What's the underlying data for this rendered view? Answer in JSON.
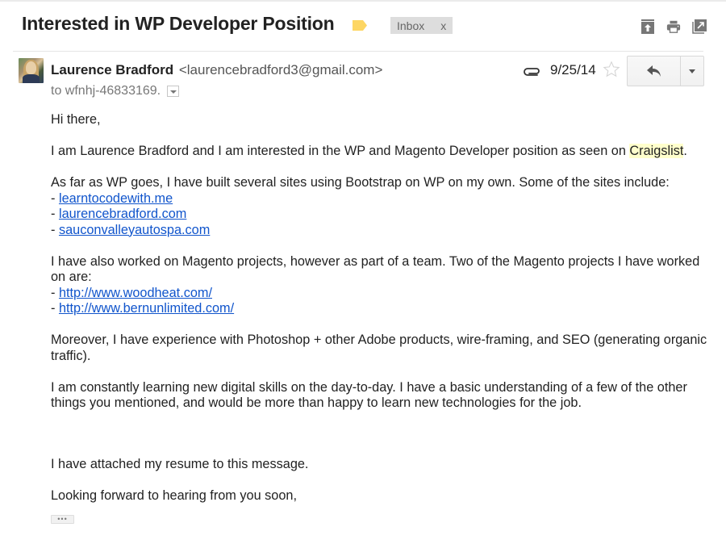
{
  "subject": "Interested in WP Developer Position",
  "label": {
    "name": "Inbox",
    "remove": "x",
    "tag_color": "#fdd663",
    "icon": "label-tag-icon"
  },
  "toolbar": {
    "icons": [
      "archive-icon",
      "print-icon",
      "new-window-icon"
    ]
  },
  "message": {
    "sender_name": "Laurence Bradford",
    "sender_email": "<laurencebradford3@gmail.com>",
    "recipient": "to wfnhj-46833169.",
    "date": "9/25/14",
    "has_attachment": true,
    "starred": false,
    "reply_icon": "reply-icon",
    "more_icon": "chevron-down-icon"
  },
  "body": {
    "greeting": "Hi there,",
    "p1_before": "I am Laurence Bradford and I am interested in the WP and Magento Developer position as seen on ",
    "p1_highlight": "Craigslist",
    "p1_after": ".",
    "p2_intro": "As far as WP goes, I have built several sites using Bootstrap on WP on my own. Some of the sites include:",
    "wp_sites": [
      "learntocodewith.me",
      "laurencebradford.com",
      "sauconvalleyautospa.com"
    ],
    "p3_intro": "I have also worked on Magento projects, however as part of a team. Two of the Magento projects I have worked on are:",
    "magento_sites": [
      "http://www.woodheat.com/",
      "http://www.bernunlimited.com/"
    ],
    "bullet": "- ",
    "p4": "Moreover, I have experience with Photoshop + other Adobe products, wire-framing, and SEO (generating organic traffic).",
    "p5": "I am constantly learning new digital skills on the day-to-day. I have a basic understanding of a few of the other things you mentioned, and would be more than happy to learn new technologies for the job.",
    "p6": "I have attached my resume to this message.",
    "closing": "Looking forward to hearing from you soon,",
    "show_trimmed": "•••"
  },
  "colors": {
    "link": "#1155cc",
    "highlight": "#ffffcc",
    "badge_bg": "#dddddd"
  }
}
